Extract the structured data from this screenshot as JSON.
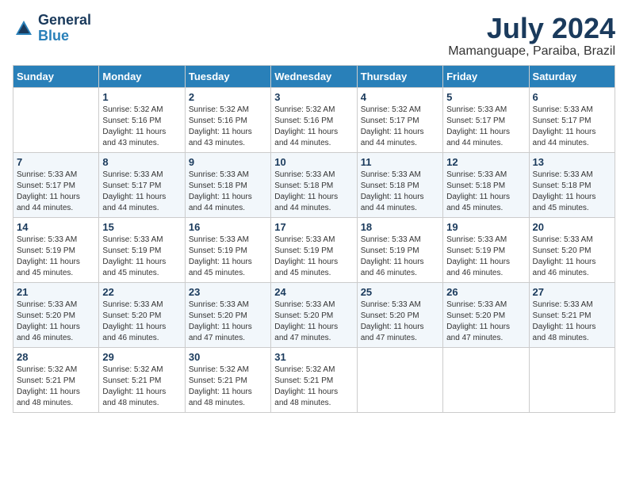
{
  "header": {
    "logo_general": "General",
    "logo_blue": "Blue",
    "title": "July 2024",
    "location": "Mamanguape, Paraiba, Brazil"
  },
  "calendar": {
    "columns": [
      "Sunday",
      "Monday",
      "Tuesday",
      "Wednesday",
      "Thursday",
      "Friday",
      "Saturday"
    ],
    "weeks": [
      [
        {
          "day": "",
          "detail": ""
        },
        {
          "day": "1",
          "detail": "Sunrise: 5:32 AM\nSunset: 5:16 PM\nDaylight: 11 hours\nand 43 minutes."
        },
        {
          "day": "2",
          "detail": "Sunrise: 5:32 AM\nSunset: 5:16 PM\nDaylight: 11 hours\nand 43 minutes."
        },
        {
          "day": "3",
          "detail": "Sunrise: 5:32 AM\nSunset: 5:16 PM\nDaylight: 11 hours\nand 44 minutes."
        },
        {
          "day": "4",
          "detail": "Sunrise: 5:32 AM\nSunset: 5:17 PM\nDaylight: 11 hours\nand 44 minutes."
        },
        {
          "day": "5",
          "detail": "Sunrise: 5:33 AM\nSunset: 5:17 PM\nDaylight: 11 hours\nand 44 minutes."
        },
        {
          "day": "6",
          "detail": "Sunrise: 5:33 AM\nSunset: 5:17 PM\nDaylight: 11 hours\nand 44 minutes."
        }
      ],
      [
        {
          "day": "7",
          "detail": "Sunrise: 5:33 AM\nSunset: 5:17 PM\nDaylight: 11 hours\nand 44 minutes."
        },
        {
          "day": "8",
          "detail": "Sunrise: 5:33 AM\nSunset: 5:17 PM\nDaylight: 11 hours\nand 44 minutes."
        },
        {
          "day": "9",
          "detail": "Sunrise: 5:33 AM\nSunset: 5:18 PM\nDaylight: 11 hours\nand 44 minutes."
        },
        {
          "day": "10",
          "detail": "Sunrise: 5:33 AM\nSunset: 5:18 PM\nDaylight: 11 hours\nand 44 minutes."
        },
        {
          "day": "11",
          "detail": "Sunrise: 5:33 AM\nSunset: 5:18 PM\nDaylight: 11 hours\nand 44 minutes."
        },
        {
          "day": "12",
          "detail": "Sunrise: 5:33 AM\nSunset: 5:18 PM\nDaylight: 11 hours\nand 45 minutes."
        },
        {
          "day": "13",
          "detail": "Sunrise: 5:33 AM\nSunset: 5:18 PM\nDaylight: 11 hours\nand 45 minutes."
        }
      ],
      [
        {
          "day": "14",
          "detail": "Sunrise: 5:33 AM\nSunset: 5:19 PM\nDaylight: 11 hours\nand 45 minutes."
        },
        {
          "day": "15",
          "detail": "Sunrise: 5:33 AM\nSunset: 5:19 PM\nDaylight: 11 hours\nand 45 minutes."
        },
        {
          "day": "16",
          "detail": "Sunrise: 5:33 AM\nSunset: 5:19 PM\nDaylight: 11 hours\nand 45 minutes."
        },
        {
          "day": "17",
          "detail": "Sunrise: 5:33 AM\nSunset: 5:19 PM\nDaylight: 11 hours\nand 45 minutes."
        },
        {
          "day": "18",
          "detail": "Sunrise: 5:33 AM\nSunset: 5:19 PM\nDaylight: 11 hours\nand 46 minutes."
        },
        {
          "day": "19",
          "detail": "Sunrise: 5:33 AM\nSunset: 5:19 PM\nDaylight: 11 hours\nand 46 minutes."
        },
        {
          "day": "20",
          "detail": "Sunrise: 5:33 AM\nSunset: 5:20 PM\nDaylight: 11 hours\nand 46 minutes."
        }
      ],
      [
        {
          "day": "21",
          "detail": "Sunrise: 5:33 AM\nSunset: 5:20 PM\nDaylight: 11 hours\nand 46 minutes."
        },
        {
          "day": "22",
          "detail": "Sunrise: 5:33 AM\nSunset: 5:20 PM\nDaylight: 11 hours\nand 46 minutes."
        },
        {
          "day": "23",
          "detail": "Sunrise: 5:33 AM\nSunset: 5:20 PM\nDaylight: 11 hours\nand 47 minutes."
        },
        {
          "day": "24",
          "detail": "Sunrise: 5:33 AM\nSunset: 5:20 PM\nDaylight: 11 hours\nand 47 minutes."
        },
        {
          "day": "25",
          "detail": "Sunrise: 5:33 AM\nSunset: 5:20 PM\nDaylight: 11 hours\nand 47 minutes."
        },
        {
          "day": "26",
          "detail": "Sunrise: 5:33 AM\nSunset: 5:20 PM\nDaylight: 11 hours\nand 47 minutes."
        },
        {
          "day": "27",
          "detail": "Sunrise: 5:33 AM\nSunset: 5:21 PM\nDaylight: 11 hours\nand 48 minutes."
        }
      ],
      [
        {
          "day": "28",
          "detail": "Sunrise: 5:32 AM\nSunset: 5:21 PM\nDaylight: 11 hours\nand 48 minutes."
        },
        {
          "day": "29",
          "detail": "Sunrise: 5:32 AM\nSunset: 5:21 PM\nDaylight: 11 hours\nand 48 minutes."
        },
        {
          "day": "30",
          "detail": "Sunrise: 5:32 AM\nSunset: 5:21 PM\nDaylight: 11 hours\nand 48 minutes."
        },
        {
          "day": "31",
          "detail": "Sunrise: 5:32 AM\nSunset: 5:21 PM\nDaylight: 11 hours\nand 48 minutes."
        },
        {
          "day": "",
          "detail": ""
        },
        {
          "day": "",
          "detail": ""
        },
        {
          "day": "",
          "detail": ""
        }
      ]
    ]
  }
}
